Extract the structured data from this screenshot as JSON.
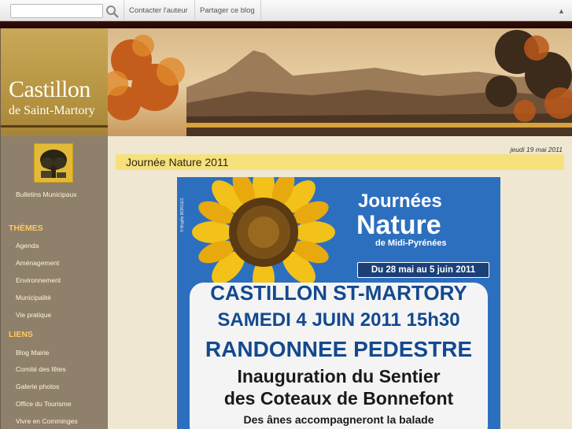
{
  "toolbar": {
    "search_value": "",
    "contact_label": "Contacter l'auteur",
    "share_label": "Partager ce blog",
    "collapse_icon": "caret-up-icon"
  },
  "sidebar": {
    "brand_title": "Castillon",
    "brand_subtitle": "de Saint-Martory",
    "bulletins_label": "Bulletins Municipaux",
    "themes_heading": "THÈMES",
    "themes": [
      "Agenda",
      "Aménagement",
      "Environnement",
      "Municipalité",
      "Vie pratique"
    ],
    "liens_heading": "LIENS",
    "liens": [
      "Blog Mairie",
      "Comité des fêtes",
      "Galerie photos",
      "Office du Tourisme",
      "Vivre en Comminges"
    ]
  },
  "post": {
    "date": "jeudi 19 mai 2011",
    "title": "Journée Nature 2011"
  },
  "poster": {
    "brand_line1": "Journées",
    "brand_line2": "Nature",
    "brand_line3": "de Midi-Pyrénées",
    "dates": "Du 28 mai au 5 juin 2011",
    "credit": "© Brigitte BORGES",
    "line1": "CASTILLON ST-MARTORY",
    "line2": "SAMEDI 4 JUIN 2011 15h30",
    "line3": "RANDONNEE PEDESTRE",
    "line4": "Inauguration du Sentier",
    "line5": "des Coteaux de Bonnefont",
    "line6": "Des ânes accompagneront la balade"
  },
  "colors": {
    "sidebar": "#8f806c",
    "accent": "#ffc95c",
    "title_band": "#f6e17c",
    "poster_blue": "#2d6fbf"
  }
}
